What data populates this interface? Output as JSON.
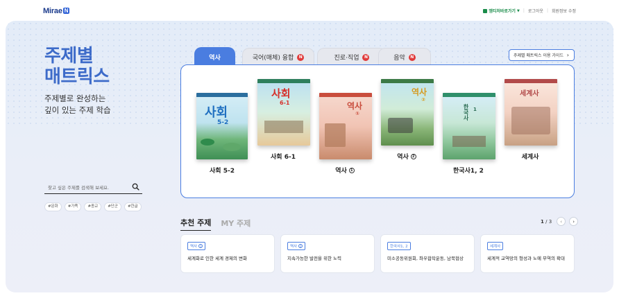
{
  "header": {
    "logo_text": "Mirae",
    "logo_badge": "N",
    "links": [
      "엠티처바로가기",
      "로그아웃",
      "회원정보 수정"
    ]
  },
  "hero": {
    "title_line1": "주제별",
    "title_line2": "매트릭스",
    "subtitle_line1": "주제별로 완성하는",
    "subtitle_line2": "깊이 있는 주제 학습",
    "search_placeholder": "찾고 싶은 주제를 검색해 보세요.",
    "tags": [
      "#문화",
      "#가족",
      "#종교",
      "#단군",
      "#한글"
    ]
  },
  "tabs": [
    {
      "label": "역사",
      "badge": "",
      "active": true
    },
    {
      "label": "국어(매체) 융합",
      "badge": "N",
      "active": false
    },
    {
      "label": "진로·직업",
      "badge": "N",
      "active": false
    },
    {
      "label": "음악",
      "badge": "N",
      "active": false
    }
  ],
  "guide_label": "주제별 매트릭스 이용 가이드",
  "books": [
    {
      "label": "사회 5-2",
      "cover_title": "사회",
      "cover_sub": "5-2",
      "circle": ""
    },
    {
      "label": "사회 6-1",
      "cover_title": "사회",
      "cover_sub": "6-1",
      "circle": ""
    },
    {
      "label": "역사",
      "cover_title": "역사",
      "cover_sub": "①",
      "circle": "1"
    },
    {
      "label": "역사",
      "cover_title": "역사",
      "cover_sub": "②",
      "circle": "2"
    },
    {
      "label": "한국사1, 2",
      "cover_title": "한국사",
      "cover_sub": "1",
      "circle": ""
    },
    {
      "label": "세계사",
      "cover_title": "세계사",
      "cover_sub": "",
      "circle": ""
    }
  ],
  "recommend": {
    "tab_active": "추천 주제",
    "tab_other": "MY 주제",
    "page_current": "1",
    "page_total": "/ 3",
    "cards": [
      {
        "chip": "역사",
        "chip_circle": "1",
        "desc": "세계화로 인한 세계 경제의 변화"
      },
      {
        "chip": "역사",
        "chip_circle": "2",
        "desc": "지속가능한 발전을 위한 노력"
      },
      {
        "chip": "한국사1, 2",
        "chip_circle": "",
        "desc": "미소공동위원회, 좌우합작운동, 남북협상"
      },
      {
        "chip": "세계사",
        "chip_circle": "",
        "desc": "세계적 교역망의 형성과 노예 무역의 확대"
      }
    ]
  },
  "colors": {
    "accent": "#4a7de0",
    "title": "#3d6bc9",
    "badge_red": "#e03a3a"
  }
}
